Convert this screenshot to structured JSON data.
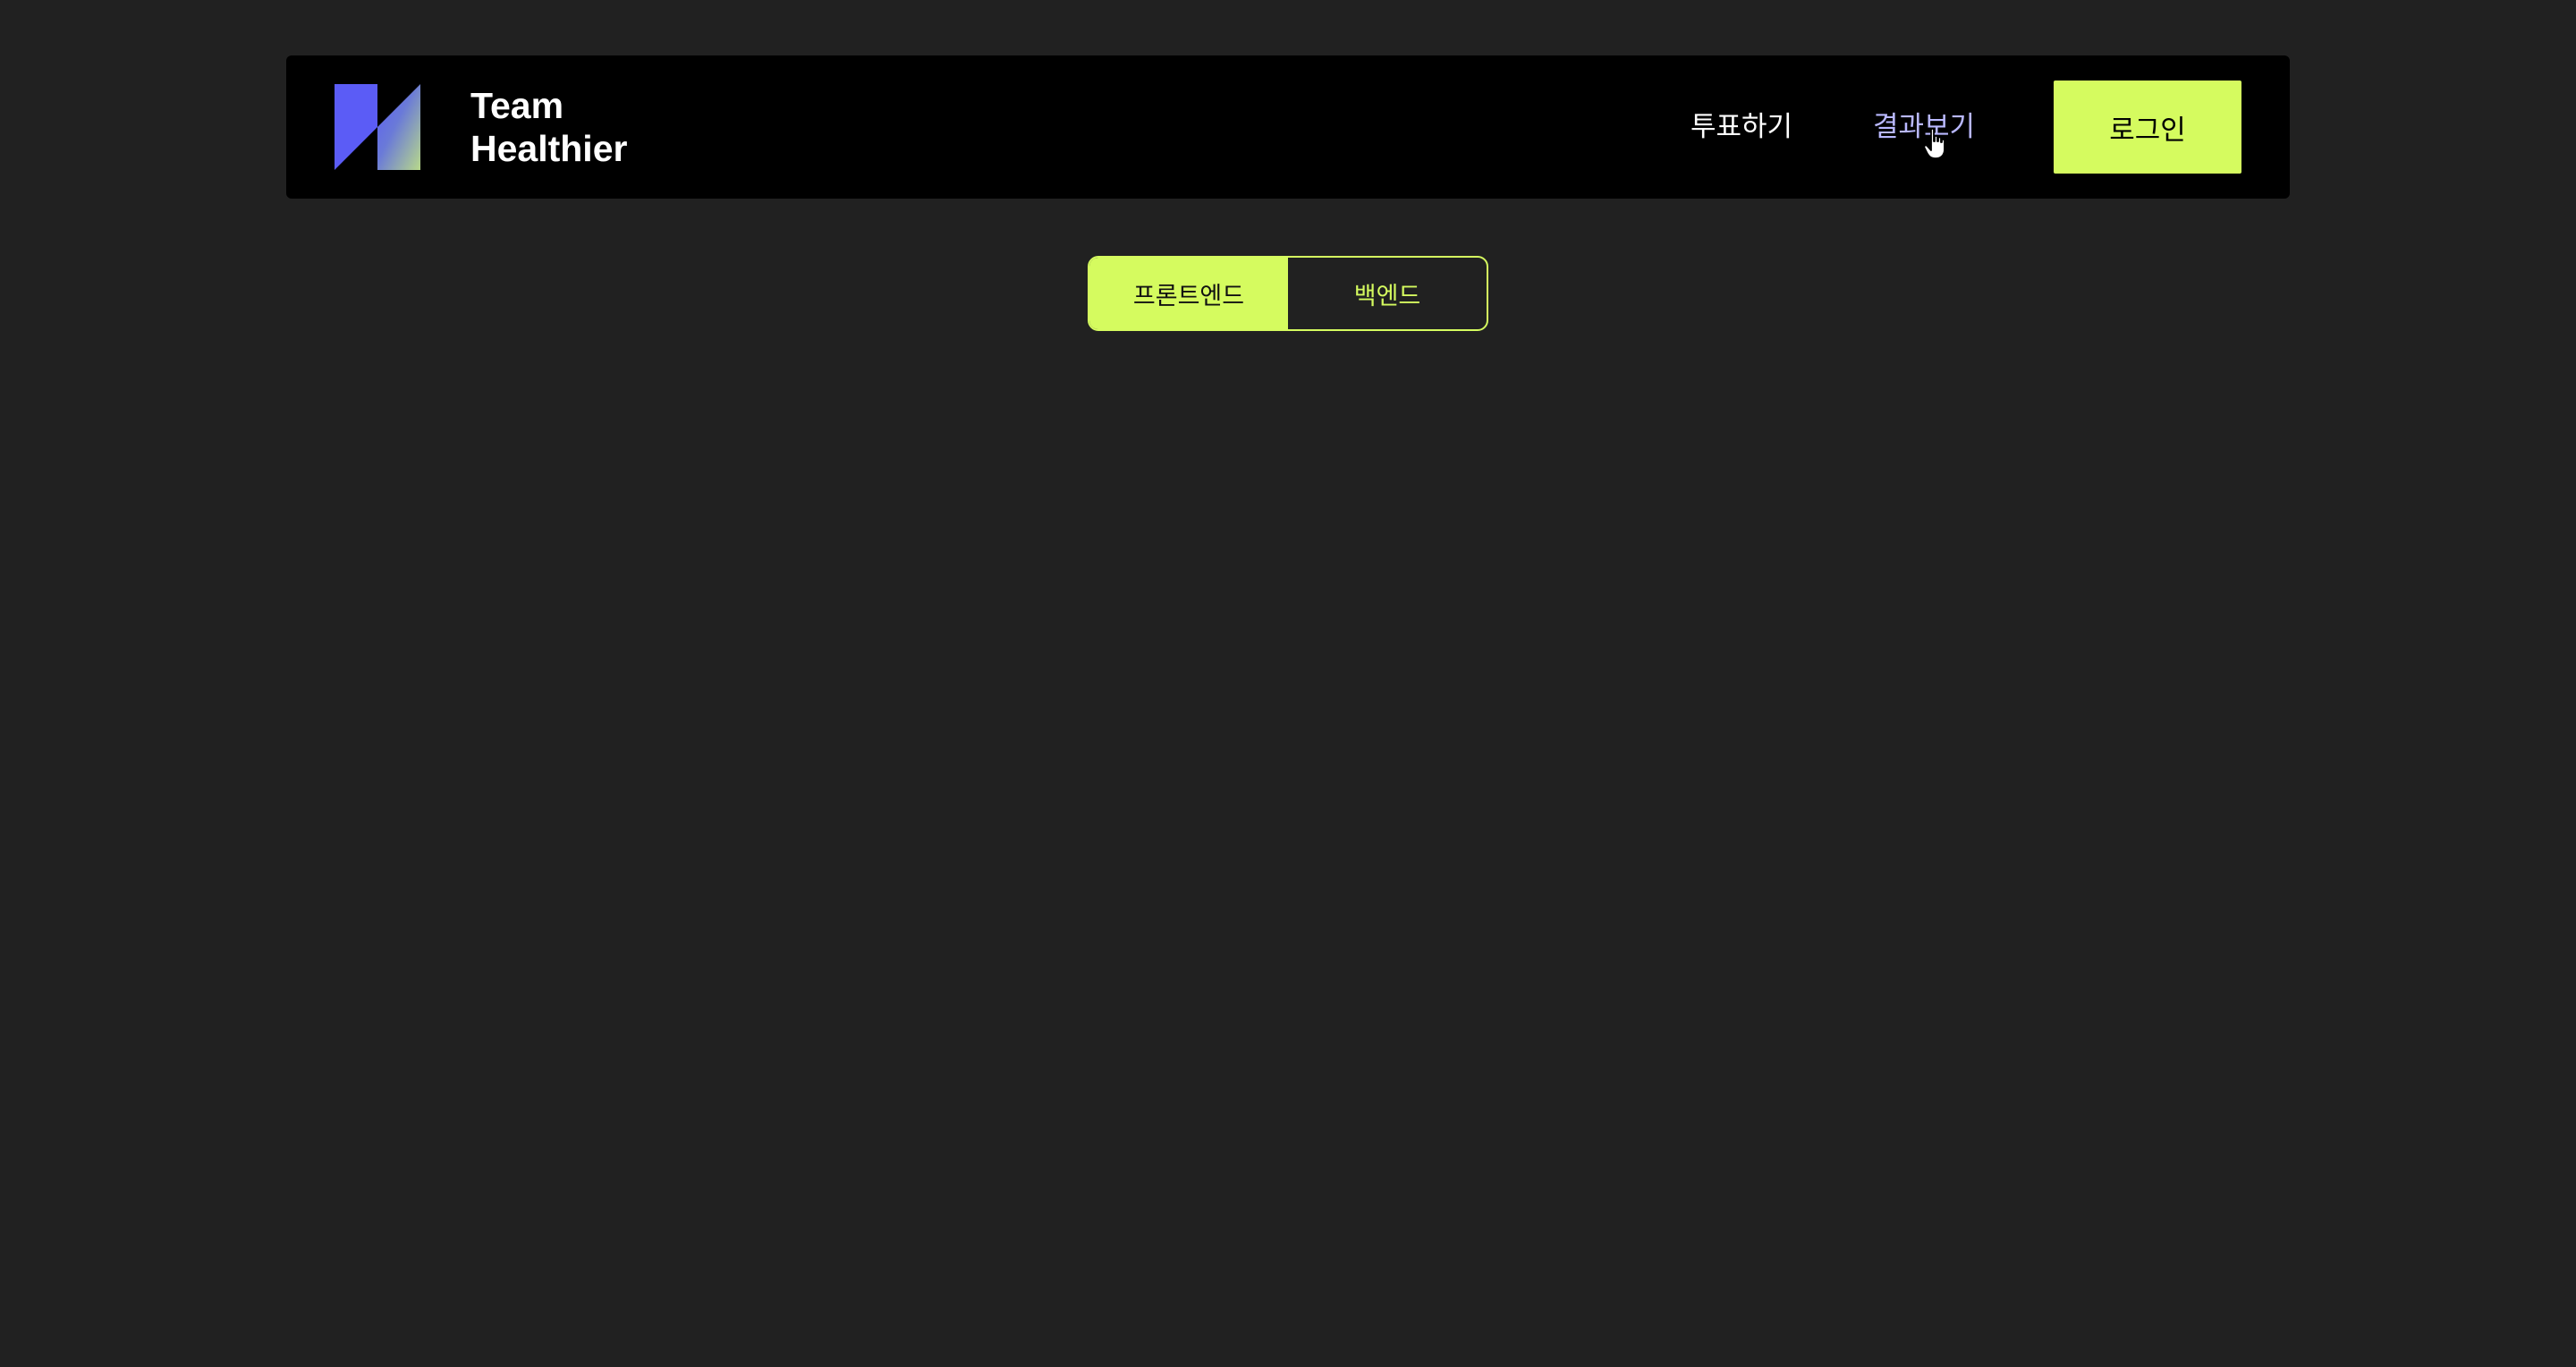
{
  "header": {
    "brand": {
      "line1": "Team",
      "line2": "Healthier",
      "logo_icon": "team-healthier-logo-icon"
    },
    "nav": [
      {
        "label": "투표하기",
        "state": "default"
      },
      {
        "label": "결과보기",
        "state": "hover"
      }
    ],
    "login_label": "로그인"
  },
  "toggle": {
    "options": [
      {
        "label": "프론트엔드",
        "selected": true
      },
      {
        "label": "백엔드",
        "selected": false
      }
    ]
  },
  "colors": {
    "background": "#212121",
    "header_bg": "#000000",
    "accent": "#d5fb5f",
    "link_hover": "#b9b8ff",
    "logo_blue": "#5b5cf6"
  }
}
